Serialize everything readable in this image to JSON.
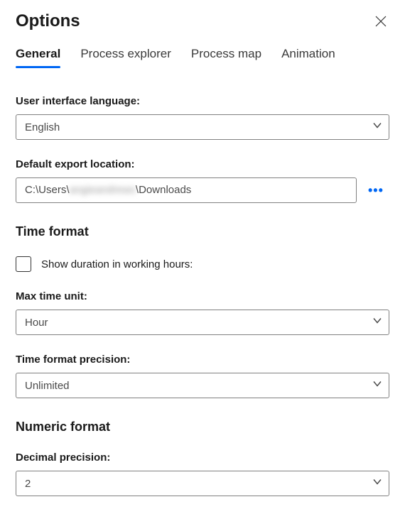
{
  "header": {
    "title": "Options"
  },
  "tabs": {
    "items": [
      {
        "label": "General",
        "active": true
      },
      {
        "label": "Process explorer",
        "active": false
      },
      {
        "label": "Process map",
        "active": false
      },
      {
        "label": "Animation",
        "active": false
      }
    ]
  },
  "general": {
    "languageLabel": "User interface language:",
    "languageValue": "English",
    "exportLabel": "Default export location:",
    "exportPrefix": "C:\\Users\\",
    "exportObscured": "angieandrews",
    "exportSuffix": "\\Downloads"
  },
  "timeFormat": {
    "heading": "Time format",
    "checkboxLabel": "Show duration in working hours:",
    "maxUnitLabel": "Max time unit:",
    "maxUnitValue": "Hour",
    "precisionLabel": "Time format precision:",
    "precisionValue": "Unlimited"
  },
  "numericFormat": {
    "heading": "Numeric format",
    "decimalLabel": "Decimal precision:",
    "decimalValue": "2"
  }
}
